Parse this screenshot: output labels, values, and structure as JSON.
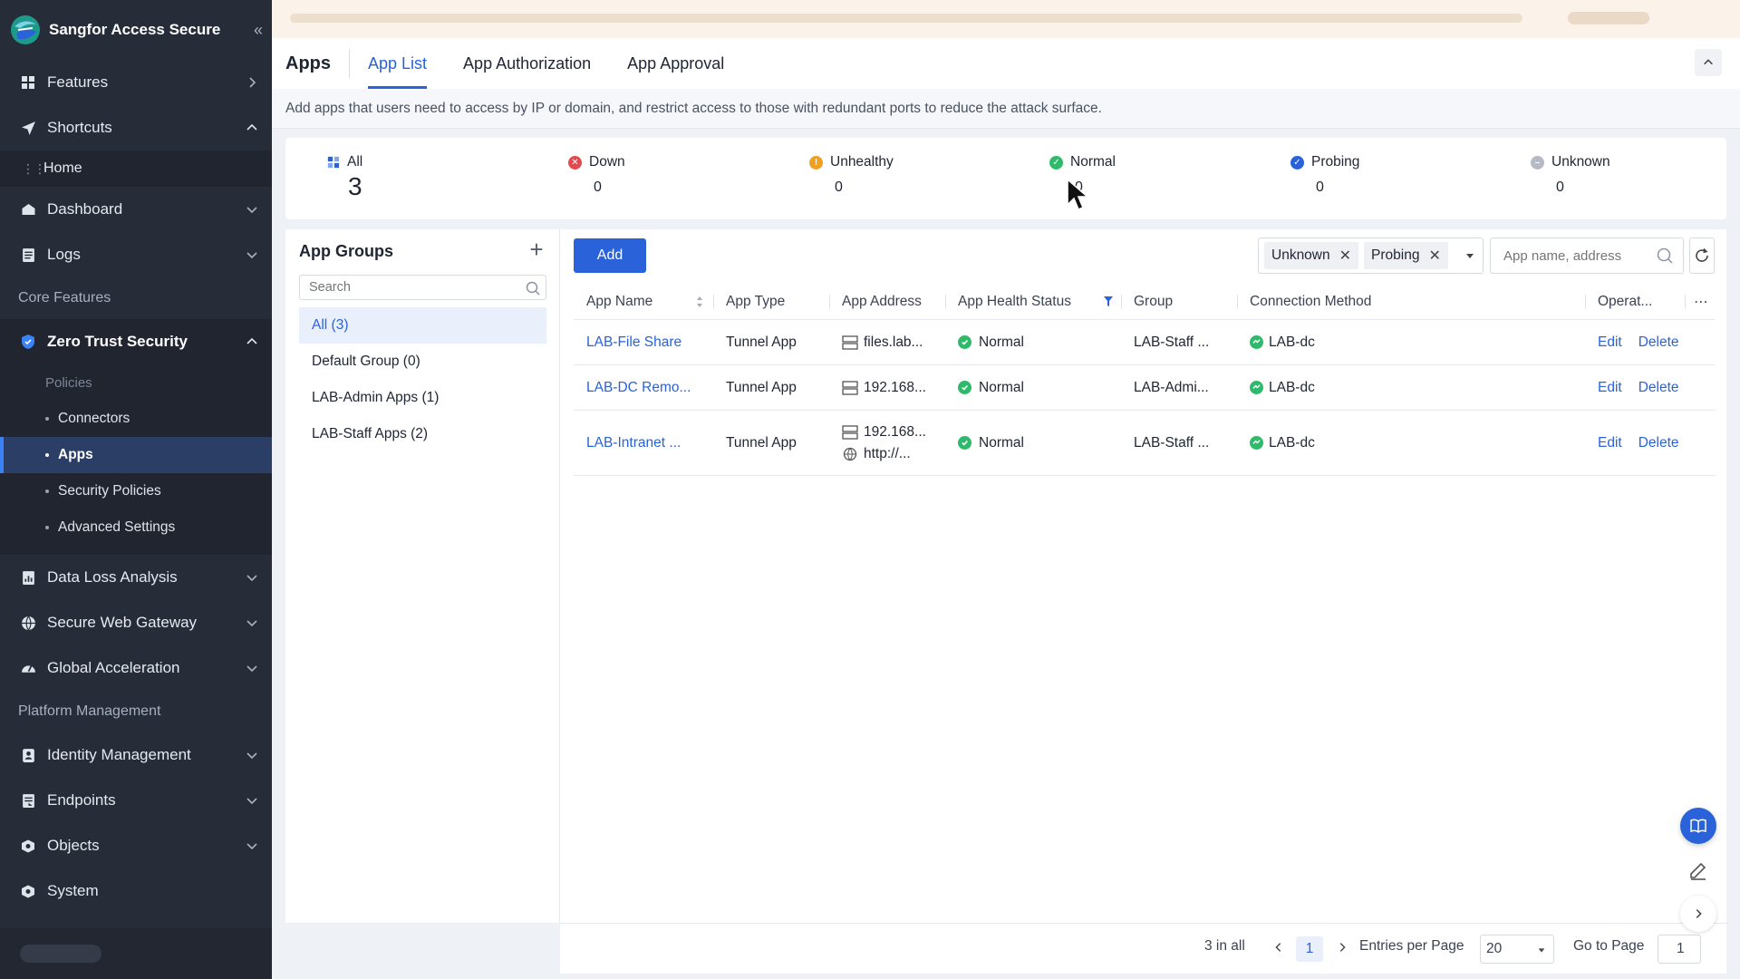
{
  "brand": {
    "name": "Sangfor Access Secure"
  },
  "sidebar": {
    "items": [
      {
        "label": "Features",
        "icon": "grid-icon"
      },
      {
        "label": "Shortcuts",
        "icon": "send-icon"
      },
      {
        "label": "Home"
      },
      {
        "label": "Dashboard",
        "icon": "dashboard-icon"
      },
      {
        "label": "Logs",
        "icon": "logs-icon"
      }
    ],
    "section_core": "Core Features",
    "zero_trust": {
      "label": "Zero Trust Security",
      "sub_title": "Policies",
      "sub_items": [
        "Connectors",
        "Apps",
        "Security Policies",
        "Advanced Settings"
      ]
    },
    "core_items": [
      {
        "label": "Data Loss Analysis"
      },
      {
        "label": "Secure Web Gateway"
      },
      {
        "label": "Global Acceleration"
      }
    ],
    "section_platform": "Platform Management",
    "platform_items": [
      {
        "label": "Identity Management"
      },
      {
        "label": "Endpoints"
      },
      {
        "label": "Objects"
      },
      {
        "label": "System"
      }
    ]
  },
  "header": {
    "title": "Apps",
    "tabs": [
      "App List",
      "App Authorization",
      "App Approval"
    ],
    "active_tab": "App List",
    "description": "Add apps that users need to access by IP or domain, and restrict access to those with redundant ports to reduce the attack surface."
  },
  "summary": [
    {
      "label": "All",
      "value": "3",
      "color": "#2a62d9"
    },
    {
      "label": "Down",
      "value": "0",
      "color": "#e5484d"
    },
    {
      "label": "Unhealthy",
      "value": "0",
      "color": "#f0a020"
    },
    {
      "label": "Normal",
      "value": "0",
      "color": "#2fb96a"
    },
    {
      "label": "Probing",
      "value": "0",
      "color": "#2a62d9"
    },
    {
      "label": "Unknown",
      "value": "0",
      "color": "#b5bac4"
    }
  ],
  "groups": {
    "title": "App Groups",
    "search_placeholder": "Search",
    "items": [
      "All (3)",
      "Default Group (0)",
      "LAB-Admin Apps (1)",
      "LAB-Staff Apps (2)"
    ]
  },
  "toolbar": {
    "add_label": "Add",
    "filters": [
      "Unknown",
      "Probing"
    ],
    "search_placeholder": "App name, address"
  },
  "table": {
    "columns": [
      "App Name",
      "App Type",
      "App Address",
      "App Health Status",
      "Group",
      "Connection Method",
      "Operat..."
    ],
    "rows": [
      {
        "name": "LAB-File Share",
        "type": "Tunnel App",
        "addresses": [
          "files.lab..."
        ],
        "health": "Normal",
        "group": "LAB-Staff ...",
        "connection": "LAB-dc"
      },
      {
        "name": "LAB-DC Remo...",
        "type": "Tunnel App",
        "addresses": [
          "192.168..."
        ],
        "health": "Normal",
        "group": "LAB-Admi...",
        "connection": "LAB-dc"
      },
      {
        "name": "LAB-Intranet ...",
        "type": "Tunnel App",
        "addresses": [
          "192.168...",
          "http://..."
        ],
        "health": "Normal",
        "group": "LAB-Staff ...",
        "connection": "LAB-dc"
      }
    ],
    "actions": {
      "edit": "Edit",
      "delete": "Delete"
    }
  },
  "pager": {
    "total": "3 in all",
    "current_page": "1",
    "entries_label": "Entries per Page",
    "entries_value": "20",
    "goto_label": "Go to Page",
    "goto_value": "1"
  }
}
